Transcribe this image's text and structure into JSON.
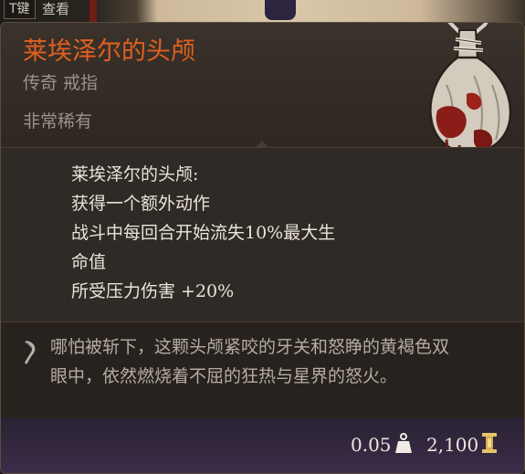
{
  "background": {
    "hotkey": "T键",
    "hotkey_action": "查看"
  },
  "item": {
    "name": "莱埃泽尔的头颅",
    "type": "传奇 戒指",
    "rarity": "非常稀有",
    "image_icon": "severed-head-sack-icon",
    "name_color": "#e3601f"
  },
  "effects": {
    "title": "莱埃泽尔的头颅:",
    "lines": [
      "获得一个额外动作",
      "战斗中每回合开始流失10%最大生",
      "命值",
      "所受压力伤害 +20%"
    ]
  },
  "lore": {
    "icon": "quill-icon",
    "lines": [
      "哪怕被斩下，这颗头颅紧咬的牙关和怒睁的黄褐色双",
      "眼中，依然燃烧着不屈的狂热与星界的怒火。"
    ]
  },
  "footer": {
    "weight": "0.05",
    "weight_icon": "weight-icon",
    "price": "2,100",
    "price_icon": "gold-coin-icon"
  }
}
